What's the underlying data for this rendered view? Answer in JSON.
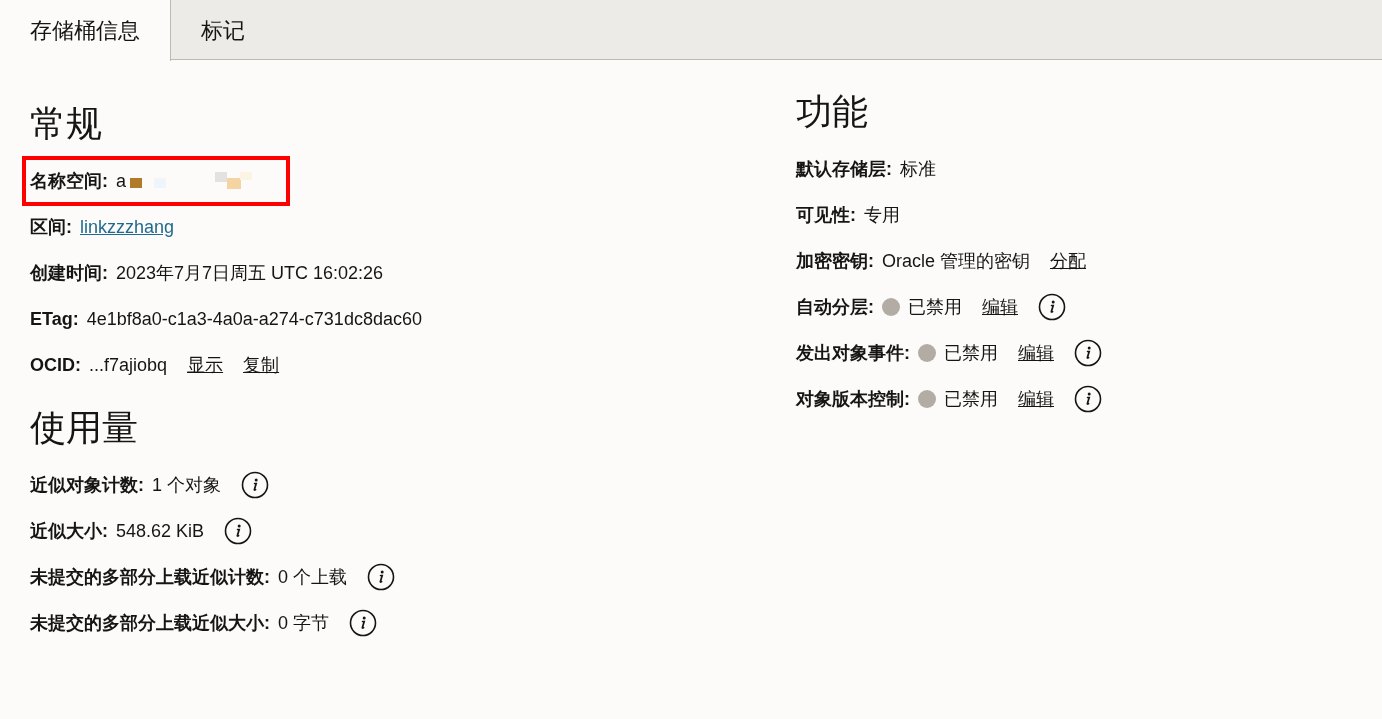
{
  "tabs": [
    {
      "label": "存储桶信息",
      "selected": true
    },
    {
      "label": "标记",
      "selected": false
    }
  ],
  "general": {
    "title": "常规",
    "fields": [
      {
        "kind": "redacted",
        "label": "名称空间:",
        "value": "a",
        "highlighted": true
      },
      {
        "kind": "link",
        "label": "区间:",
        "value": "linkzzzhang"
      },
      {
        "kind": "text",
        "label": "创建时间:",
        "value": "2023年7月7日周五 UTC 16:02:26"
      },
      {
        "kind": "text",
        "label": "ETag:",
        "value": "4e1bf8a0-c1a3-4a0a-a274-c731dc8dac60"
      },
      {
        "kind": "text",
        "label": "OCID:",
        "value": "...f7ajiobq",
        "actions": [
          "显示",
          "复制"
        ]
      }
    ]
  },
  "usage": {
    "title": "使用量",
    "fields": [
      {
        "kind": "text",
        "label": "近似对象计数:",
        "value": "1 个对象",
        "info": true
      },
      {
        "kind": "text",
        "label": "近似大小:",
        "value": "548.62 KiB",
        "info": true
      },
      {
        "kind": "text",
        "label": "未提交的多部分上载近似计数:",
        "value": "0 个上载",
        "info": true
      },
      {
        "kind": "text",
        "label": "未提交的多部分上载近似大小:",
        "value": "0 字节",
        "info": true
      }
    ]
  },
  "features": {
    "title": "功能",
    "fields": [
      {
        "kind": "text",
        "label": "默认存储层:",
        "value": "标准"
      },
      {
        "kind": "text",
        "label": "可见性:",
        "value": "专用"
      },
      {
        "kind": "text",
        "label": "加密密钥:",
        "value": "Oracle 管理的密钥",
        "actions": [
          "分配"
        ]
      },
      {
        "kind": "status",
        "label": "自动分层:",
        "value": "已禁用",
        "enabled": false,
        "actions": [
          "编辑"
        ],
        "info": true
      },
      {
        "kind": "status",
        "label": "发出对象事件:",
        "value": "已禁用",
        "enabled": false,
        "actions": [
          "编辑"
        ],
        "info": true
      },
      {
        "kind": "status",
        "label": "对象版本控制:",
        "value": "已禁用",
        "enabled": false,
        "actions": [
          "编辑"
        ],
        "info": true
      }
    ]
  }
}
